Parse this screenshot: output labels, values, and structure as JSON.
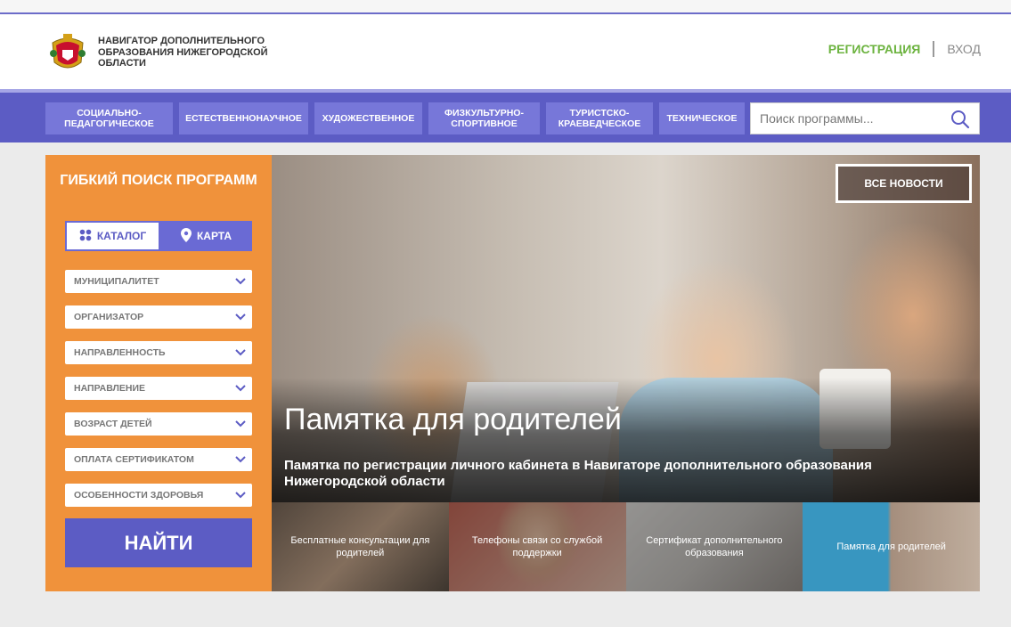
{
  "header": {
    "logo_text": "НАВИГАТОР ДОПОЛНИТЕЛЬНОГО ОБРАЗОВАНИЯ НИЖЕГОРОДСКОЙ ОБЛАСТИ",
    "register": "РЕГИСТРАЦИЯ",
    "login": "ВХОД"
  },
  "nav": {
    "items": [
      "СОЦИАЛЬНО-ПЕДАГОГИЧЕСКОЕ",
      "ЕСТЕСТВЕННОНАУЧНОЕ",
      "ХУДОЖЕСТВЕННОЕ",
      "ФИЗКУЛЬТУРНО-СПОРТИВНОЕ",
      "ТУРИСТСКО-КРАЕВЕДЧЕСКОЕ",
      "ТЕХНИЧЕСКОЕ"
    ],
    "search_placeholder": "Поиск программы..."
  },
  "filter": {
    "title": "ГИБКИЙ ПОИСК ПРОГРАММ",
    "tab_catalog": "КАТАЛОГ",
    "tab_map": "КАРТА",
    "selects": [
      "МУНИЦИПАЛИТЕТ",
      "ОРГАНИЗАТОР",
      "НАПРАВЛЕННОСТЬ",
      "НАПРАВЛЕНИЕ",
      "ВОЗРАСТ ДЕТЕЙ",
      "ОПЛАТА СЕРТИФИКАТОМ",
      "ОСОБЕННОСТИ ЗДОРОВЬЯ"
    ],
    "find_button": "НАЙТИ"
  },
  "hero": {
    "title": "Памятка для родителей",
    "subtitle": "Памятка по регистрации личного кабинета в Навигаторе дополнительного образования Нижегородской области",
    "all_news": "ВСЕ НОВОСТИ"
  },
  "thumbs": [
    "Бесплатные консультации для родителей",
    "Телефоны связи со службой поддержки",
    "Сертификат дополнительного образования",
    "Памятка для родителей"
  ],
  "colors": {
    "accent": "#5c5cc4",
    "orange": "#f0923b",
    "green": "#6cb33f"
  }
}
